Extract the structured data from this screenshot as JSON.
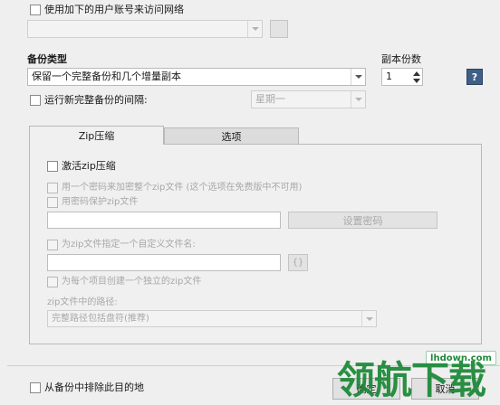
{
  "network": {
    "use_account_label": "使用加下的用户账号来访问网络",
    "account_value": ""
  },
  "backup_type": {
    "heading": "备份类型",
    "selected": "保留一个完整备份和几个增量副本"
  },
  "copies": {
    "heading": "副本份数",
    "value": "1"
  },
  "help_button_label": "?",
  "interval": {
    "label": "运行新完整备份的间隔:",
    "selected": "星期一"
  },
  "tabs": [
    {
      "label": "Zip压缩",
      "active": true
    },
    {
      "label": "选项",
      "active": false
    }
  ],
  "zip": {
    "activate_label": "激活zip压缩",
    "one_password_label": "用一个密码来加密整个zip文件 (这个选项在免费版中不可用)",
    "password_protect_label": "用密码保护zip文件",
    "password_value": "",
    "set_password_button": "设置密码",
    "custom_name_label": "为zip文件指定一个自定义文件名:",
    "custom_name_value": "",
    "browse_button": "{}",
    "per_item_label": "为每个项目创建一个独立的zip文件",
    "path_heading": "zip文件中的路径:",
    "path_selected": "完整路径包括盘符(推荐)"
  },
  "footer": {
    "exclude_label": "从备份中排除此目的地",
    "ok_button": "确定",
    "cancel_button": "取消"
  },
  "watermark": {
    "text": "领航下载",
    "domain": "lhdown.com"
  },
  "colors": {
    "background": "#efefef",
    "help_bg": "#3f5f86",
    "watermark": "#1f8a3a"
  }
}
